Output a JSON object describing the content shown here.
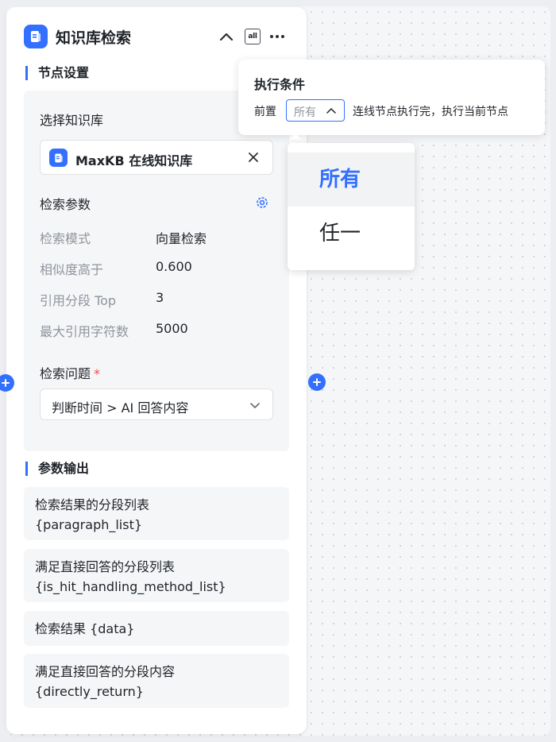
{
  "node": {
    "title": "知识库检索",
    "all_button_label": "all",
    "settings_title": "节点设置",
    "knowledge_base_label": "选择知识库",
    "knowledge_base_name": "MaxKB 在线知识库",
    "search_params_label": "检索参数",
    "params": [
      {
        "key": "检索模式",
        "value": "向量检索"
      },
      {
        "key": "相似度高于",
        "value": "0.600"
      },
      {
        "key": "引用分段 Top",
        "value": "3"
      },
      {
        "key": "最大引用字符数",
        "value": "5000"
      }
    ],
    "question_label": "检索问题",
    "required_mark": "*",
    "question_value": "判断时间 > AI 回答内容",
    "output_title": "参数输出",
    "outputs": [
      {
        "label": "检索结果的分段列表",
        "var": "{paragraph_list}"
      },
      {
        "label": "满足直接回答的分段列表",
        "var": "{is_hit_handling_method_list}"
      },
      {
        "label": "检索结果 {data}",
        "var": ""
      },
      {
        "label": "满足直接回答的分段内容",
        "var": "{directly_return}"
      }
    ]
  },
  "condition_popover": {
    "title": "执行条件",
    "prefix": "前置",
    "selected": "所有",
    "description": "连线节点执行完，执行当前节点"
  },
  "dropdown": {
    "options": [
      {
        "label": "所有",
        "active": true
      },
      {
        "label": "任一",
        "active": false
      }
    ]
  },
  "colors": {
    "accent": "#3370ff",
    "required": "#f54a45",
    "muted_text": "#8f959e",
    "text": "#1f2329"
  },
  "icons": {
    "app": "knowledge-base-icon",
    "collapse": "chevron-up-icon",
    "more": "more-dots-icon",
    "close": "close-icon",
    "settings": "gear-icon",
    "select_arrow": "chevron-down-icon",
    "port": "plus-icon"
  }
}
